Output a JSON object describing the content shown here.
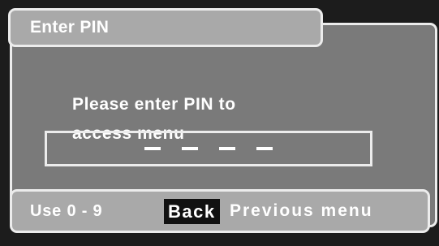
{
  "dialog": {
    "title": "Enter PIN",
    "message_line1": "Please enter PIN to",
    "message_line2": "access menu"
  },
  "pin_input": {
    "digit_count": 4,
    "entered": "",
    "placeholder_glyph": "_"
  },
  "footer": {
    "hint": "Use 0 - 9",
    "back_key_label": "Back",
    "back_description": "Previous menu"
  },
  "colors": {
    "background": "#1c1c1c",
    "panel": "#7a7a7a",
    "title_bar": "#a9a9a9",
    "border": "#ececec",
    "text": "#ffffff",
    "key_highlight": "#111111"
  }
}
